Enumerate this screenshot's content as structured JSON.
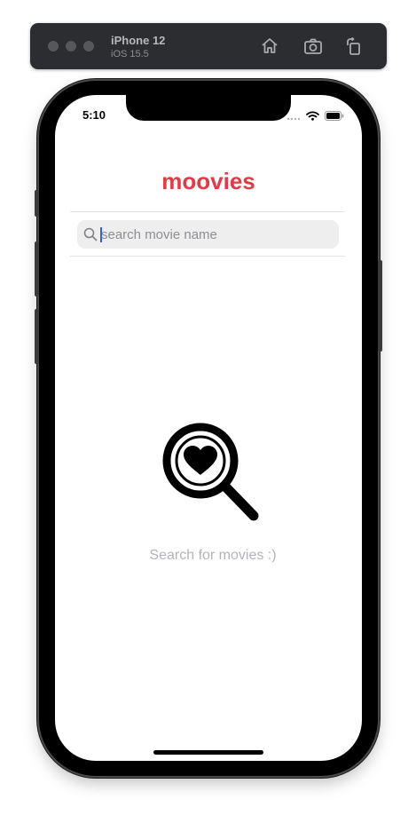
{
  "simulator": {
    "device_name": "iPhone 12",
    "os_version": "iOS 15.5",
    "icons": [
      "home-icon",
      "screenshot-icon",
      "rotate-icon"
    ]
  },
  "status_bar": {
    "time": "5:10",
    "icons": [
      "signal-icon",
      "wifi-icon",
      "battery-icon"
    ]
  },
  "app": {
    "title": "moovies",
    "accent_color": "#e53945"
  },
  "search": {
    "placeholder": "search movie name",
    "value": ""
  },
  "empty_state": {
    "icon": "heart-magnifier-icon",
    "message": "Search for movies :)"
  }
}
